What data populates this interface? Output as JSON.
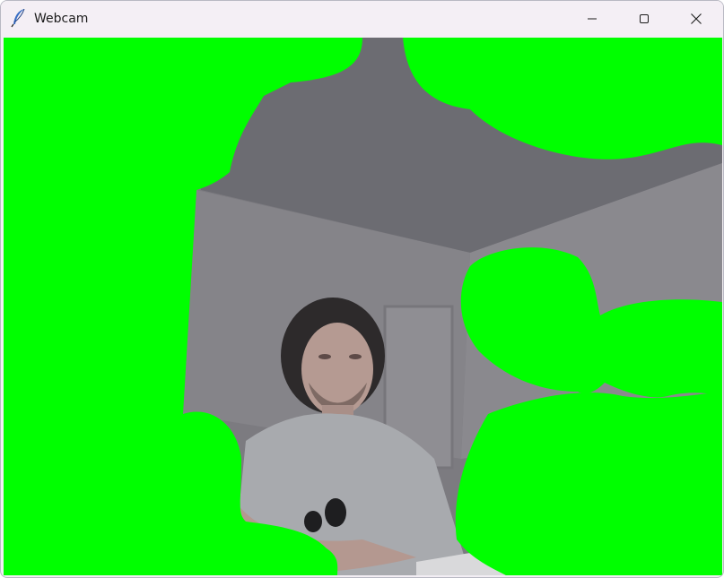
{
  "window": {
    "title": "Webcam",
    "app_icon": "feather-icon",
    "controls": {
      "minimize_icon": "minimize-icon",
      "maximize_icon": "maximize-icon",
      "close_icon": "close-icon"
    }
  },
  "feed": {
    "chroma_color": "#00ff00",
    "wall_color": "#7c7b80",
    "ceiling_color": "#6f6f74",
    "shirt_color": "#a8aaae"
  }
}
